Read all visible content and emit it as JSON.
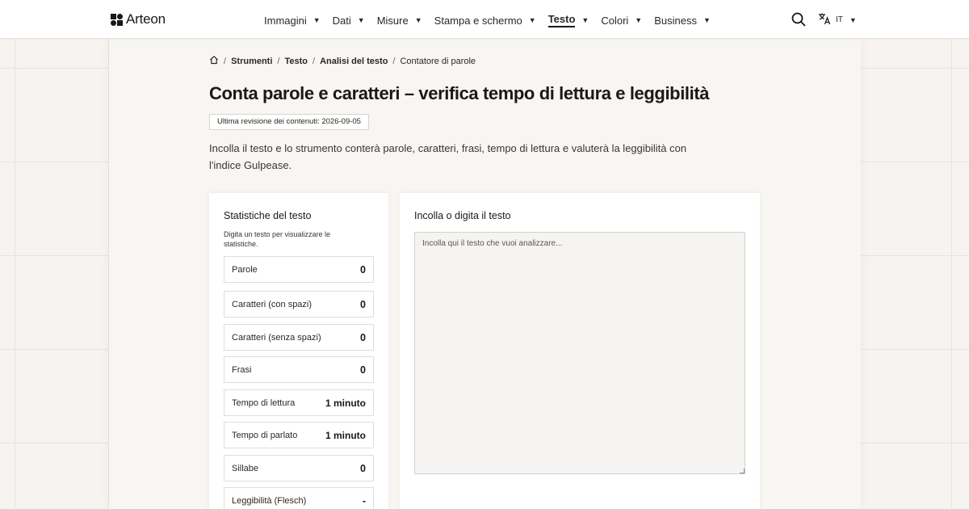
{
  "brand": {
    "name": "Arteon"
  },
  "nav": {
    "items": [
      {
        "label": "Immagini",
        "active": false
      },
      {
        "label": "Dati",
        "active": false
      },
      {
        "label": "Misure",
        "active": false
      },
      {
        "label": "Stampa e schermo",
        "active": false
      },
      {
        "label": "Testo",
        "active": true
      },
      {
        "label": "Colori",
        "active": false
      },
      {
        "label": "Business",
        "active": false
      }
    ],
    "caret": "▼",
    "search_icon": "search-icon",
    "language": {
      "icon": "translate-icon",
      "code": "IT"
    }
  },
  "breadcrumb": {
    "home_icon": "home-icon",
    "separator": "/",
    "items": [
      "Strumenti",
      "Testo",
      "Analisi del testo",
      "Contatore di parole"
    ]
  },
  "page": {
    "title": "Conta parole e caratteri – verifica tempo di lettura e leggibilità",
    "revision": "Ultima revisione dei contenuti: 2026-09-05",
    "intro": "Incolla il testo e lo strumento conterà parole, caratteri, frasi, tempo di lettura e valuterà la leggibilità con l'indice Gulpease."
  },
  "stats": {
    "title": "Statistiche del testo",
    "hint": "Digita un testo per visualizzare le statistiche.",
    "rows": [
      {
        "label": "Parole",
        "value": "0"
      },
      {
        "label": "Caratteri (con spazi)",
        "value": "0"
      },
      {
        "label": "Caratteri (senza spazi)",
        "value": "0"
      },
      {
        "label": "Frasi",
        "value": "0"
      },
      {
        "label": "Tempo di lettura",
        "value": "1 minuto"
      },
      {
        "label": "Tempo di parlato",
        "value": "1 minuto"
      },
      {
        "label": "Sillabe",
        "value": "0"
      },
      {
        "label": "Leggibilità (Flesch)",
        "value": "-"
      }
    ]
  },
  "editor": {
    "title": "Incolla o digita il testo",
    "placeholder": "Incolla qui il testo che vuoi analizzare...",
    "value": ""
  },
  "colors": {
    "background": "#f6f3f0",
    "text": "#1b1917",
    "card": "#ffffff"
  }
}
